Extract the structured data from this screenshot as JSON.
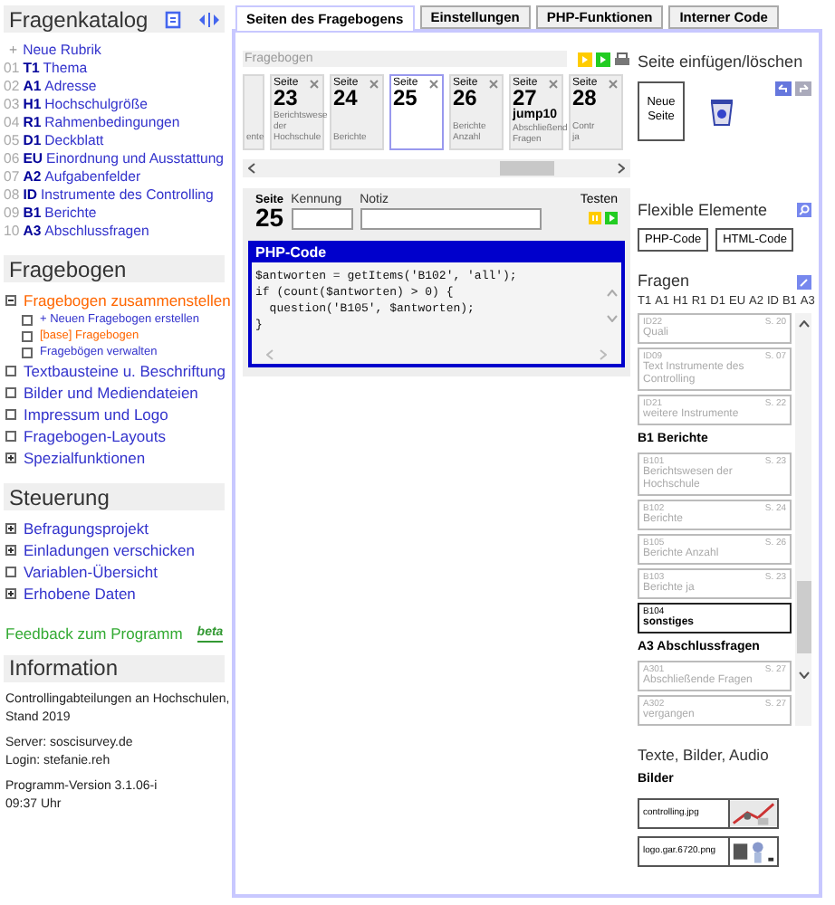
{
  "sidebar": {
    "catalog": {
      "title": "Fragenkatalog",
      "new_icon": "+",
      "new_label": "Neue Rubrik",
      "items": [
        {
          "number": "01",
          "code": "T1",
          "name": "Thema"
        },
        {
          "number": "02",
          "code": "A1",
          "name": "Adresse"
        },
        {
          "number": "03",
          "code": "H1",
          "name": "Hochschulgröße"
        },
        {
          "number": "04",
          "code": "R1",
          "name": "Rahmenbedingungen"
        },
        {
          "number": "05",
          "code": "D1",
          "name": "Deckblatt"
        },
        {
          "number": "06",
          "code": "EU",
          "name": "Einordnung und Ausstattung"
        },
        {
          "number": "07",
          "code": "A2",
          "name": "Aufgabenfelder"
        },
        {
          "number": "08",
          "code": "ID",
          "name": "Instrumente des Controlling"
        },
        {
          "number": "09",
          "code": "B1",
          "name": "Berichte"
        },
        {
          "number": "10",
          "code": "A3",
          "name": "Abschlussfragen"
        }
      ]
    },
    "questionnaire": {
      "title": "Fragebogen",
      "items": [
        {
          "label": "Fragebogen zusammenstellen",
          "kind": "folder",
          "expanded": true,
          "selected": true,
          "children": [
            {
              "label": "+ Neuen Fragebogen erstellen",
              "kind": "page",
              "selected": false
            },
            {
              "label": "[base] Fragebogen",
              "kind": "page",
              "selected": true
            },
            {
              "label": "Fragebögen verwalten",
              "kind": "page",
              "selected": false
            }
          ]
        },
        {
          "label": "Textbausteine u. Beschriftung",
          "kind": "page",
          "selected": false
        },
        {
          "label": "Bilder und Mediendateien",
          "kind": "page",
          "selected": false
        },
        {
          "label": "Impressum und Logo",
          "kind": "page",
          "selected": false
        },
        {
          "label": "Fragebogen-Layouts",
          "kind": "page",
          "selected": false
        },
        {
          "label": "Spezialfunktionen",
          "kind": "folder",
          "expanded": false,
          "selected": false
        }
      ]
    },
    "control": {
      "title": "Steuerung",
      "items": [
        {
          "label": "Befragungsprojekt",
          "kind": "folder",
          "expanded": false,
          "selected": false
        },
        {
          "label": "Einladungen verschicken",
          "kind": "folder",
          "expanded": false,
          "selected": false
        },
        {
          "label": "Variablen-Übersicht",
          "kind": "page",
          "selected": false
        },
        {
          "label": "Erhobene Daten",
          "kind": "folder",
          "expanded": false,
          "selected": false
        }
      ]
    },
    "feedback": {
      "label": "Feedback zum Programm",
      "badge": "beta"
    },
    "information": {
      "title": "Information",
      "paragraphs": [
        [
          "Controllingabteilungen an Hochschulen,",
          "Stand 2019"
        ],
        [
          "Server: soscisurvey.de",
          "Login: stefanie.reh"
        ],
        [
          "Programm-Version 3.1.06-i",
          "09:37 Uhr"
        ]
      ]
    }
  },
  "tabs": [
    {
      "label": "Seiten des Fragebogens",
      "selected": true
    },
    {
      "label": "Einstellungen",
      "selected": false
    },
    {
      "label": "PHP-Funktionen",
      "selected": false
    },
    {
      "label": "Interner Code",
      "selected": false
    }
  ],
  "pages": {
    "title": "Fragebogen",
    "cards": [
      {
        "kind": "partial",
        "lines": [
          "ente"
        ],
        "selected": false
      },
      {
        "kind": "page",
        "header": "Seite",
        "number": "23",
        "lines": [
          "Berichtswese",
          "der",
          "Hochschule"
        ],
        "selected": false
      },
      {
        "kind": "page",
        "header": "Seite",
        "number": "24",
        "lines": [
          "Berichte"
        ],
        "selected": false
      },
      {
        "kind": "page",
        "header": "Seite",
        "number": "25",
        "selected": true
      },
      {
        "kind": "page",
        "header": "Seite",
        "number": "26",
        "lines": [
          "Berichte",
          "Anzahl"
        ],
        "selected": false
      },
      {
        "kind": "page",
        "header": "Seite",
        "number": "27",
        "jump": "jump10",
        "lines": [
          "Abschließend",
          "Fragen"
        ],
        "selected": false
      },
      {
        "kind": "page",
        "header": "Seite",
        "number": "28",
        "lines": [
          "Contr",
          "ja"
        ],
        "selected": false
      }
    ]
  },
  "page_detail": {
    "header": "Seite",
    "number": "25",
    "id_label": "Kennung",
    "note_label": "Notiz",
    "test_label": "Testen",
    "code_title": "PHP-Code",
    "code": [
      "$antworten = getItems('B102', 'all');",
      "if (count($antworten) > 0) {",
      "  question('B105', $antworten);",
      "}"
    ]
  },
  "insert": {
    "title": "Seite einfügen/löschen",
    "new_page": "Neue Seite"
  },
  "flexible": {
    "title": "Flexible Elemente",
    "buttons": [
      "PHP-Code",
      "HTML-Code"
    ]
  },
  "questions": {
    "title": "Fragen",
    "letters": [
      "T1",
      "A1",
      "H1",
      "R1",
      "D1",
      "EU",
      "A2",
      "ID",
      "B1",
      "A3"
    ],
    "items": [
      {
        "kind": "question",
        "id": "ID22",
        "page": "S. 20",
        "text": "Quali",
        "used": true
      },
      {
        "kind": "question",
        "id": "ID09",
        "page": "S. 07",
        "text": "Text Instrumente des Controlling",
        "used": true
      },
      {
        "kind": "question",
        "id": "ID21",
        "page": "S. 22",
        "text": "weitere Instrumente",
        "used": true
      },
      {
        "kind": "heading",
        "text": "B1 Berichte"
      },
      {
        "kind": "question",
        "id": "B101",
        "page": "S. 23",
        "text": "Berichtswesen der Hochschule",
        "used": true
      },
      {
        "kind": "question",
        "id": "B102",
        "page": "S. 24",
        "text": "Berichte",
        "used": true
      },
      {
        "kind": "question",
        "id": "B105",
        "page": "S. 26",
        "text": "Berichte Anzahl",
        "used": true
      },
      {
        "kind": "question",
        "id": "B103",
        "page": "S. 23",
        "text": "Berichte ja",
        "used": true
      },
      {
        "kind": "question",
        "id": "B104",
        "text": "sonstiges",
        "used": false
      },
      {
        "kind": "heading",
        "text": "A3 Abschlussfragen"
      },
      {
        "kind": "question",
        "id": "A301",
        "page": "S. 27",
        "text": "Abschließende Fragen",
        "used": true
      },
      {
        "kind": "question",
        "id": "A302",
        "page": "S. 27",
        "text": "vergangen",
        "used": true
      }
    ]
  },
  "media": {
    "title": "Texte, Bilder, Audio",
    "subtitle": "Bilder",
    "files": [
      "controlling.jpg",
      "logo.gar.6720.png"
    ]
  }
}
